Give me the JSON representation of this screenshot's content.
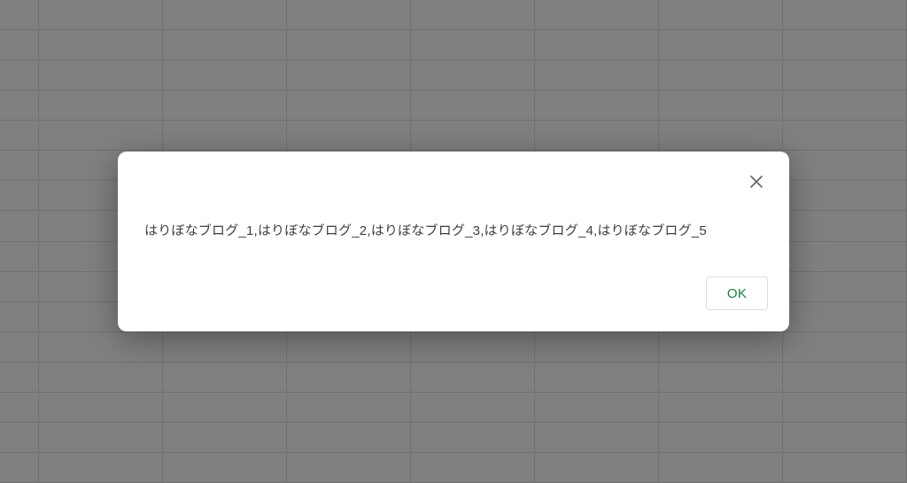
{
  "modal": {
    "message": "はりぼなブログ_1,はりぼなブログ_2,はりぼなブログ_3,はりぼなブログ_4,はりぼなブログ_5",
    "ok_label": "OK"
  },
  "grid": {
    "rows": 16,
    "cols": 8
  }
}
